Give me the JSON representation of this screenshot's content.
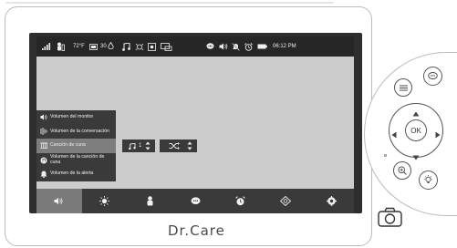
{
  "status_bar": {
    "temperature": "72°F",
    "humidity": "30",
    "time": "06:12 PM"
  },
  "menu": {
    "items": [
      {
        "label": "Volumen del monitor",
        "icon": "speaker-icon",
        "selected": false
      },
      {
        "label": "Volumen de la conversación",
        "icon": "talk-icon",
        "selected": false
      },
      {
        "label": "Canción de cuna",
        "icon": "lullaby-icon",
        "selected": true
      },
      {
        "label": "Volumen de la canción de cuna",
        "icon": "lullaby-volume-icon",
        "selected": false
      },
      {
        "label": "Volumen de la alerta",
        "icon": "alert-icon",
        "selected": false
      }
    ]
  },
  "submenu": {
    "song_value": "1",
    "song_icon": "music-note-icon",
    "mode_icon": "shuffle-icon"
  },
  "toolbar": {
    "buttons": [
      {
        "icon": "speaker-icon",
        "active": true
      },
      {
        "icon": "brightness-icon",
        "active": false
      },
      {
        "icon": "baby-icon",
        "active": false
      },
      {
        "icon": "talk-bubble-icon",
        "active": false
      },
      {
        "icon": "alarm-icon",
        "active": false
      },
      {
        "icon": "camera-switch-icon",
        "active": false
      },
      {
        "icon": "settings-icon",
        "active": false
      }
    ]
  },
  "device": {
    "brand": "Dr.Care",
    "ok_label": "OK"
  }
}
